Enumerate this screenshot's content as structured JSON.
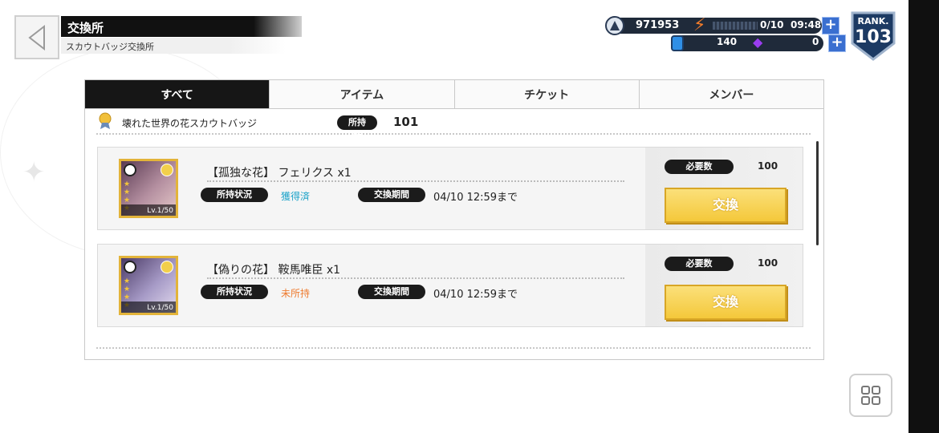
{
  "header": {
    "title": "交換所",
    "subtitle": "スカウトバッジ交換所"
  },
  "currency": {
    "coins": "971953",
    "energy": "0/10",
    "energy_timer": "09:48",
    "blue_gems": "140",
    "purple_gems": "0"
  },
  "rank": {
    "label": "RANK.",
    "value": "103"
  },
  "tabs": [
    {
      "label": "すべて"
    },
    {
      "label": "アイテム"
    },
    {
      "label": "チケット"
    },
    {
      "label": "メンバー"
    }
  ],
  "badge": {
    "name": "壊れた世界の花スカウトバッジ",
    "owned_label": "所持数",
    "owned_value": "101"
  },
  "items": [
    {
      "name": "【孤独な花】 フェリクス x1",
      "level": "Lv.1/50",
      "status_label": "所持状況",
      "status_value": "獲得済",
      "period_label": "交換期間",
      "period_value": "04/10 12:59まで",
      "need_label": "必要数",
      "need_value": "100",
      "button_label": "交換"
    },
    {
      "name": "【偽りの花】 鞍馬唯臣 x1",
      "level": "Lv.1/50",
      "status_label": "所持状況",
      "status_value": "未所持",
      "period_label": "交換期間",
      "period_value": "04/10 12:59まで",
      "need_label": "必要数",
      "need_value": "100",
      "button_label": "交換"
    }
  ],
  "colors": {
    "accent_status_ok": "#1ba3c9",
    "accent_status_ng": "#ee7b2f",
    "button_yellow": "#f4c83a"
  }
}
